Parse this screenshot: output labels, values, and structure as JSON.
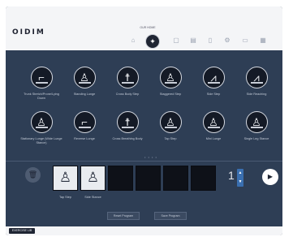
{
  "app": {
    "logo": "OIDIM",
    "home_label": "OUR HOME"
  },
  "status": {
    "left": "—",
    "right": "—"
  },
  "toolbar": {
    "icons": [
      "home-icon",
      "calendar-icon",
      "clipboard-icon",
      "device-icon",
      "person-icon",
      "gear-icon",
      "chat-icon",
      "menu-icon"
    ]
  },
  "exercises": [
    {
      "label": "Trunk Stretch/Prone/Lying Down",
      "icon": "lying-stretch-icon"
    },
    {
      "label": "Standing Lunge",
      "icon": "lunge-icon"
    },
    {
      "label": "Cross Body Step",
      "icon": "cross-step-icon"
    },
    {
      "label": "Staggered Step",
      "icon": "staggered-step-icon"
    },
    {
      "label": "Side Step",
      "icon": "side-step-icon"
    },
    {
      "label": "Side Reaching",
      "icon": "side-reach-icon"
    },
    {
      "label": "Stationary Lunge (Wide Lunge Stance)",
      "icon": "wide-lunge-icon"
    },
    {
      "label": "Reverse Lunge",
      "icon": "reverse-lunge-icon"
    },
    {
      "label": "Cross Breathing Body",
      "icon": "breathing-icon"
    },
    {
      "label": "Tap Step",
      "icon": "tap-step-icon"
    },
    {
      "label": "Mini Lunge",
      "icon": "mini-lunge-icon"
    },
    {
      "label": "Single Leg Stance",
      "icon": "single-leg-icon"
    }
  ],
  "pager": "• • • •",
  "sequence": {
    "slots": [
      {
        "label": "Tap Step",
        "filled": true
      },
      {
        "label": "Side Stance",
        "filled": true
      },
      {
        "label": "",
        "filled": false
      },
      {
        "label": "",
        "filled": false
      },
      {
        "label": "",
        "filled": false
      },
      {
        "label": "",
        "filled": false
      }
    ],
    "repeat_count": "1",
    "stepper_up": "▲",
    "stepper_down": "▼",
    "play_symbol": "▶",
    "trash_symbol": "🗑"
  },
  "buttons": {
    "reset": "Reset Program",
    "save": "Save Program"
  },
  "bottom": {
    "tab_label": "EXERCISE LIB",
    "right_text": ""
  },
  "colors": {
    "background": "#2e3e55",
    "accent": "#3a6fb0",
    "topbar": "#f4f5f7"
  }
}
